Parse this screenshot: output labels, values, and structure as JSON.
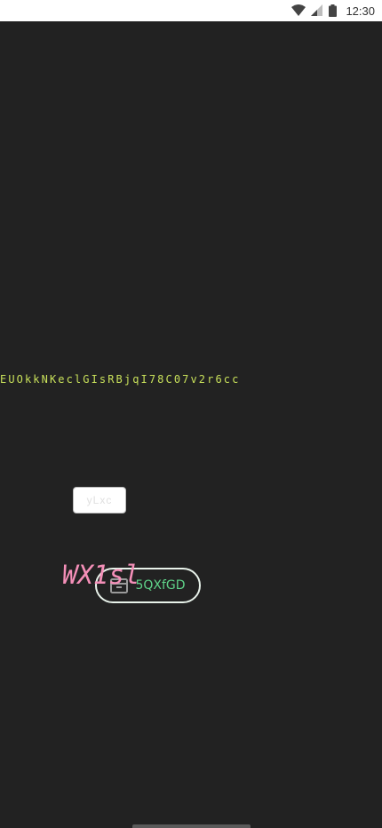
{
  "status_bar": {
    "time": "12:30",
    "icons": [
      "wifi-icon",
      "signal-icon",
      "battery-icon"
    ]
  },
  "main": {
    "mono_text": "EUOkkNKeclGIsRBjqI78C07v2r6cc",
    "input": {
      "value": "",
      "placeholder": "yLxc"
    },
    "button": {
      "icon": "archive-icon",
      "label": "5QXfGD"
    },
    "overlay_text": "WX1sl"
  },
  "colors": {
    "background": "#222222",
    "mono_text": "#c8e05a",
    "button_text": "#5fd389",
    "overlay_text": "#f48fb8"
  }
}
